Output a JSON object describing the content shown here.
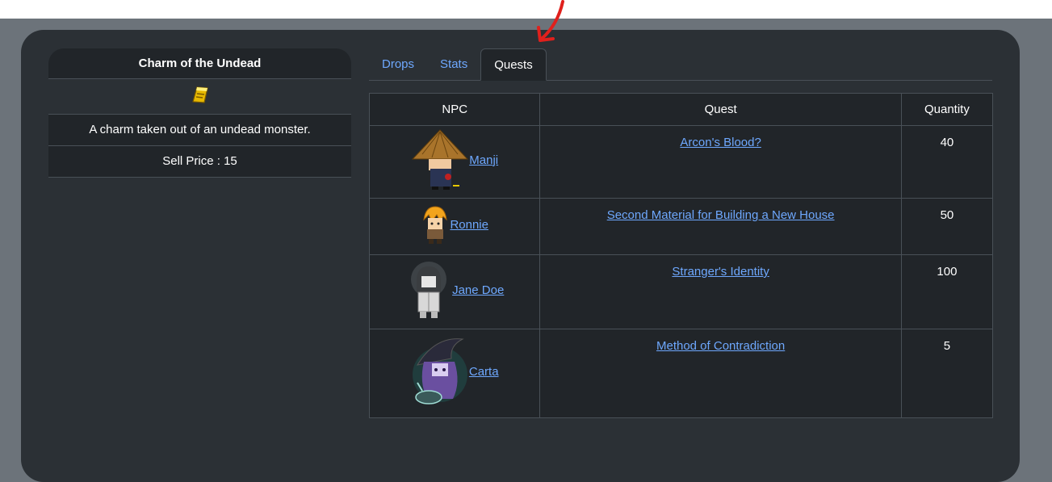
{
  "item": {
    "name": "Charm of the Undead",
    "description": "A charm taken out of an undead monster.",
    "sell_price": "Sell Price : 15"
  },
  "tabs": [
    {
      "label": "Drops",
      "active": false
    },
    {
      "label": "Stats",
      "active": false
    },
    {
      "label": "Quests",
      "active": true
    }
  ],
  "table": {
    "headers": [
      "NPC",
      "Quest",
      "Quantity"
    ],
    "rows": [
      {
        "npc": " Manji",
        "quest": "Arcon's Blood?",
        "quantity": "40"
      },
      {
        "npc": " Ronnie",
        "quest": "Second Material for Building a New House",
        "quantity": "50"
      },
      {
        "npc": " Jane Doe",
        "quest": "Stranger's Identity",
        "quantity": "100"
      },
      {
        "npc": " Carta",
        "quest": "Method of Contradiction",
        "quantity": "5"
      }
    ]
  },
  "colors": {
    "link": "#6ea8fe",
    "panel": "#212529",
    "card": "#2b3035",
    "annotation_arrow": "#e0201c"
  },
  "icons": [
    "charm-item-icon",
    "npc-manji-sprite",
    "npc-ronnie-sprite",
    "npc-jane-doe-sprite",
    "npc-carta-sprite",
    "annotation-arrow-icon"
  ]
}
